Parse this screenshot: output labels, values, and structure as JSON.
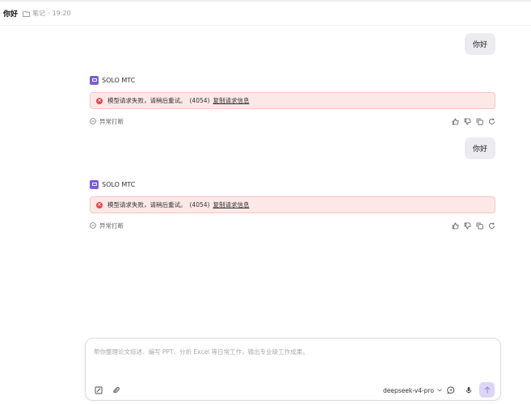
{
  "header": {
    "title": "你好",
    "folder_label": "笔记",
    "separator": "·",
    "time": "19:20"
  },
  "messages": [
    {
      "user_text": "你好",
      "ai_name": "SOLO MTC",
      "error_text": "模型请求失败，请稍后重试。",
      "error_code": "(4054)",
      "error_link": "复制请求信息",
      "interrupt_label": "异常打断"
    },
    {
      "user_text": "你好",
      "ai_name": "SOLO MTC",
      "error_text": "模型请求失败，请稍后重试。",
      "error_code": "(4054)",
      "error_link": "复制请求信息",
      "interrupt_label": "异常打断"
    }
  ],
  "composer": {
    "placeholder": "帮你整理论文综述、编写 PPT、分析 Excel 等日常工作，输出专业级工作成果。",
    "model": "deepseek-v4-pro"
  },
  "icons": {
    "folder": "folder-icon",
    "ai_logo": "solo-logo-icon",
    "error": "error-circle-icon",
    "interrupt": "minus-circle-icon",
    "thumbs_up": "thumbs-up-icon",
    "thumbs_down": "thumbs-down-icon",
    "copy": "copy-icon",
    "regenerate": "refresh-icon",
    "new_doc": "edit-icon",
    "attach": "paperclip-icon",
    "chat_mode": "chat-icon",
    "voice": "microphone-icon",
    "send": "arrow-up-icon"
  },
  "colors": {
    "accent": "#7c5cd6",
    "error_bg": "#fde8e8",
    "error_border": "#f6c5c5",
    "error_icon": "#e5484d",
    "user_bubble": "#ececf0",
    "send_button": "#ddd6f7"
  }
}
